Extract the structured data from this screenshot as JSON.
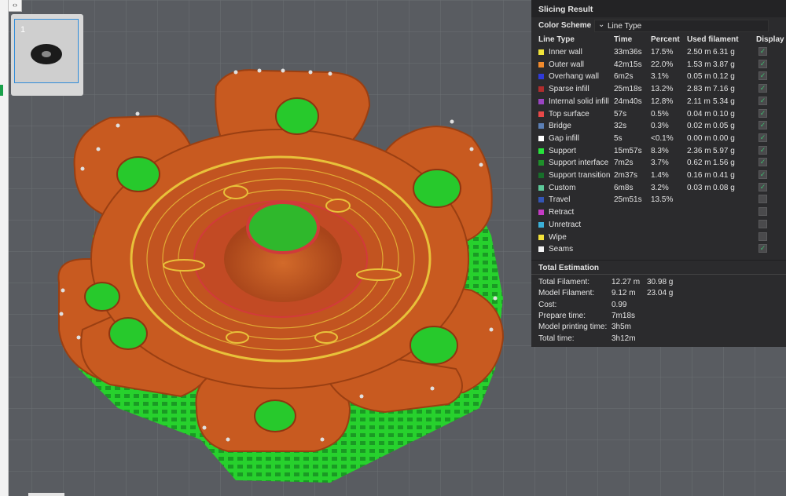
{
  "panel": {
    "title": "Slicing Result",
    "color_scheme_label": "Color Scheme",
    "color_scheme_value": "Line Type",
    "headers": {
      "line_type": "Line Type",
      "time": "Time",
      "percent": "Percent",
      "used_filament": "Used filament",
      "display": "Display"
    },
    "rows": [
      {
        "name": "Inner wall",
        "time": "33m36s",
        "percent": "17.5%",
        "length": "2.50 m",
        "weight": "6.31 g",
        "color": "#f0e33a",
        "checked": true
      },
      {
        "name": "Outer wall",
        "time": "42m15s",
        "percent": "22.0%",
        "length": "1.53 m",
        "weight": "3.87 g",
        "color": "#f08a2c",
        "checked": true
      },
      {
        "name": "Overhang wall",
        "time": "6m2s",
        "percent": "3.1%",
        "length": "0.05 m",
        "weight": "0.12 g",
        "color": "#2f3ad8",
        "checked": true
      },
      {
        "name": "Sparse infill",
        "time": "25m18s",
        "percent": "13.2%",
        "length": "2.83 m",
        "weight": "7.16 g",
        "color": "#b02d2d",
        "checked": true
      },
      {
        "name": "Internal solid infill",
        "time": "24m40s",
        "percent": "12.8%",
        "length": "2.11 m",
        "weight": "5.34 g",
        "color": "#9a44c2",
        "checked": true
      },
      {
        "name": "Top surface",
        "time": "57s",
        "percent": "0.5%",
        "length": "0.04 m",
        "weight": "0.10 g",
        "color": "#e84848",
        "checked": true
      },
      {
        "name": "Bridge",
        "time": "32s",
        "percent": "0.3%",
        "length": "0.02 m",
        "weight": "0.05 g",
        "color": "#5b7fb5",
        "checked": true
      },
      {
        "name": "Gap infill",
        "time": "5s",
        "percent": "<0.1%",
        "length": "0.00 m",
        "weight": "0.00 g",
        "color": "#ffffff",
        "checked": true
      },
      {
        "name": "Support",
        "time": "15m57s",
        "percent": "8.3%",
        "length": "2.36 m",
        "weight": "5.97 g",
        "color": "#27e33b",
        "checked": true
      },
      {
        "name": "Support interface",
        "time": "7m2s",
        "percent": "3.7%",
        "length": "0.62 m",
        "weight": "1.56 g",
        "color": "#1e8f2a",
        "checked": true
      },
      {
        "name": "Support transition",
        "time": "2m37s",
        "percent": "1.4%",
        "length": "0.16 m",
        "weight": "0.41 g",
        "color": "#17702a",
        "checked": true
      },
      {
        "name": "Custom",
        "time": "6m8s",
        "percent": "3.2%",
        "length": "0.03 m",
        "weight": "0.08 g",
        "color": "#5dc99a",
        "checked": true
      },
      {
        "name": "Travel",
        "time": "25m51s",
        "percent": "13.5%",
        "length": "",
        "weight": "",
        "color": "#3355b5",
        "checked": false
      },
      {
        "name": "Retract",
        "time": "",
        "percent": "",
        "length": "",
        "weight": "",
        "color": "#c43bc4",
        "checked": false
      },
      {
        "name": "Unretract",
        "time": "",
        "percent": "",
        "length": "",
        "weight": "",
        "color": "#3bb0d8",
        "checked": false
      },
      {
        "name": "Wipe",
        "time": "",
        "percent": "",
        "length": "",
        "weight": "",
        "color": "#f3e23a",
        "checked": false
      },
      {
        "name": "Seams",
        "time": "",
        "percent": "",
        "length": "",
        "weight": "",
        "color": "#f2f2f2",
        "checked": true
      }
    ],
    "estimation": {
      "title": "Total Estimation",
      "rows": [
        {
          "label": "Total Filament:",
          "value": "12.27 m",
          "value2": "30.98 g"
        },
        {
          "label": "Model Filament:",
          "value": "9.12 m",
          "value2": "23.04 g"
        },
        {
          "label": "Cost:",
          "value": "0.99",
          "value2": ""
        },
        {
          "label": "Prepare time:",
          "value": "7m18s",
          "value2": ""
        },
        {
          "label": "Model printing time:",
          "value": "3h5m",
          "value2": ""
        },
        {
          "label": "Total time:",
          "value": "3h12m",
          "value2": ""
        }
      ]
    }
  },
  "plate": {
    "number": "1"
  },
  "collapse_icon": "expand-collapse-icon",
  "colors": {
    "grid_bg": "#5a5d62",
    "grid_line": "#6a6d72",
    "model_orange": "#c7561f",
    "support_green": "#2fcf28",
    "wall_yellow": "#e5c23a"
  }
}
